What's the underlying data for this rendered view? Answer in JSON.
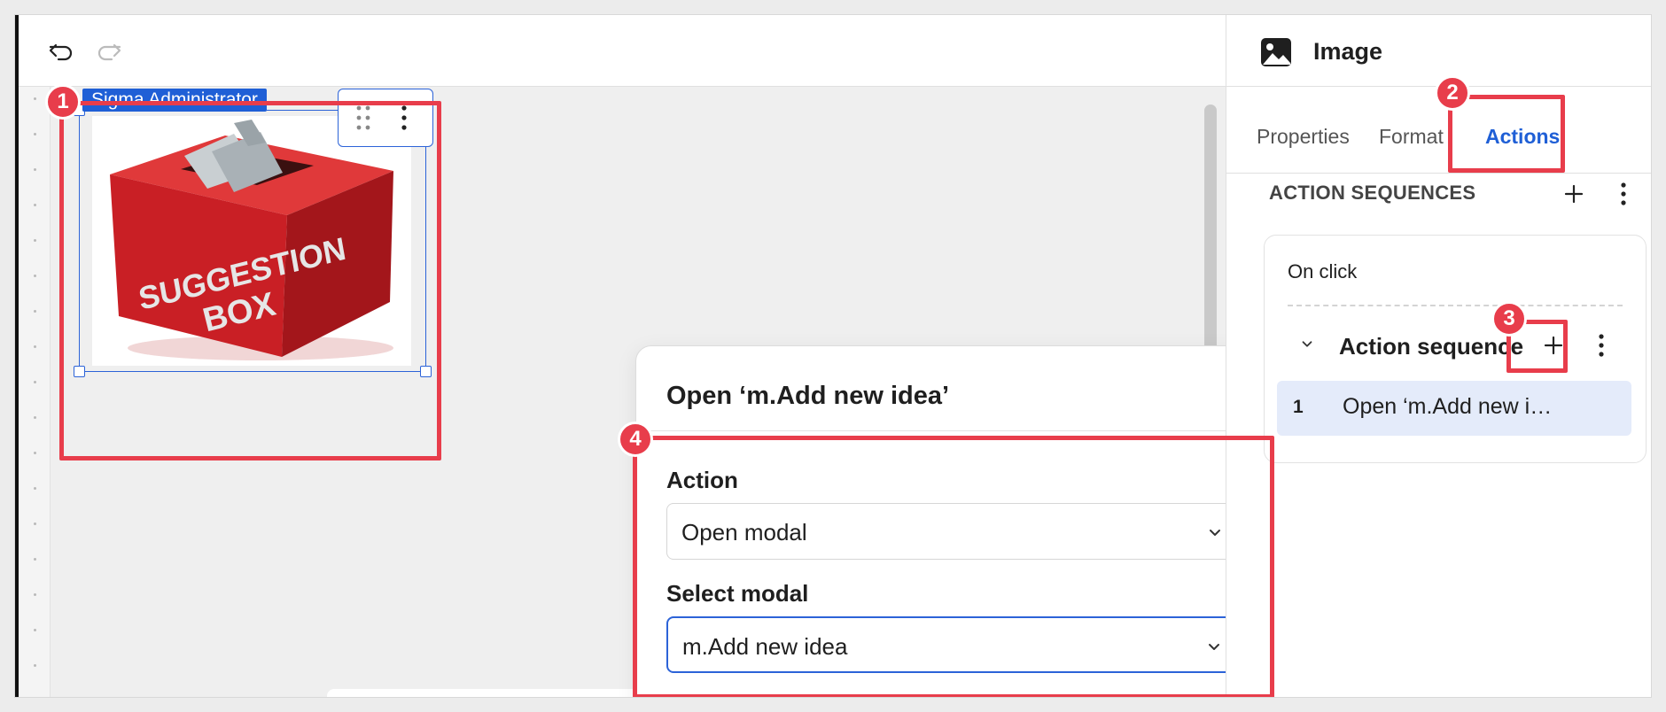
{
  "canvas": {
    "image_element": {
      "owner_tag": "Sigma Administrator",
      "image_text_line1": "SUGGESTION",
      "image_text_line2": "BOX"
    }
  },
  "modal": {
    "title": "Open ‘m.Add new idea’",
    "action_label": "Action",
    "action_value": "Open modal",
    "select_modal_label": "Select modal",
    "select_modal_value": "m.Add new idea"
  },
  "panel": {
    "title": "Image",
    "tabs": [
      {
        "label": "Properties"
      },
      {
        "label": "Format"
      },
      {
        "label": "Actions"
      }
    ],
    "section_title": "ACTION SEQUENCES",
    "trigger_label": "On click",
    "sequence_title": "Action sequence",
    "steps": [
      {
        "number": "1",
        "text": "Open ‘m.Add new i…"
      }
    ]
  },
  "callouts": [
    "1",
    "2",
    "3",
    "4"
  ],
  "colors": {
    "accent": "#1f5fd6",
    "callout": "#e83d4b",
    "step_highlight": "#e4ebfa",
    "box_red": "#d8262d"
  }
}
